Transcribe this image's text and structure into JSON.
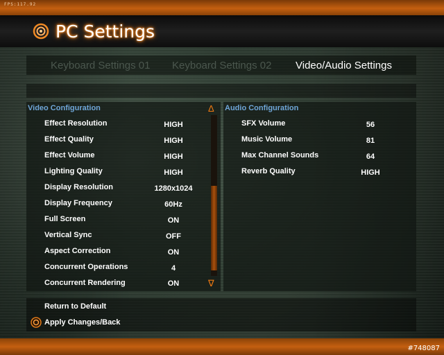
{
  "header": {
    "fps_text": "FPS:117.92",
    "title": "PC Settings",
    "title_icon": "gear-ring-icon"
  },
  "tabs": [
    {
      "label": "Keyboard Settings 01",
      "active": false
    },
    {
      "label": "Keyboard Settings 02",
      "active": false
    },
    {
      "label": "Video/Audio Settings",
      "active": true
    }
  ],
  "video": {
    "title": "Video Configuration",
    "rows": [
      {
        "label": "Effect Resolution",
        "value": "HIGH"
      },
      {
        "label": "Effect Quality",
        "value": "HIGH"
      },
      {
        "label": "Effect Volume",
        "value": "HIGH"
      },
      {
        "label": "Lighting Quality",
        "value": "HIGH"
      },
      {
        "label": "Display Resolution",
        "value": "1280x1024"
      },
      {
        "label": "Display Frequency",
        "value": "60Hz"
      },
      {
        "label": "Full Screen",
        "value": "ON"
      },
      {
        "label": "Vertical Sync",
        "value": "OFF"
      },
      {
        "label": "Aspect Correction",
        "value": "ON"
      },
      {
        "label": "Concurrent Operations",
        "value": "4"
      },
      {
        "label": "Concurrent Rendering",
        "value": "ON"
      }
    ],
    "scroll_up": "Δ",
    "scroll_down": "∇"
  },
  "audio": {
    "title": "Audio Configuration",
    "rows": [
      {
        "label": "SFX Volume",
        "value": "56"
      },
      {
        "label": "Music Volume",
        "value": "81"
      },
      {
        "label": "Max Channel Sounds",
        "value": "64"
      },
      {
        "label": "Reverb Quality",
        "value": "HIGH"
      }
    ]
  },
  "footer": {
    "return_default": "Return to Default",
    "apply_back": "Apply Changes/Back",
    "apply_icon": "confirm-button-icon",
    "watermark": "#748087"
  },
  "colors": {
    "accent_orange": "#c45f10",
    "section_blue": "#6fa6d8",
    "inactive_tab": "#4b574e"
  }
}
